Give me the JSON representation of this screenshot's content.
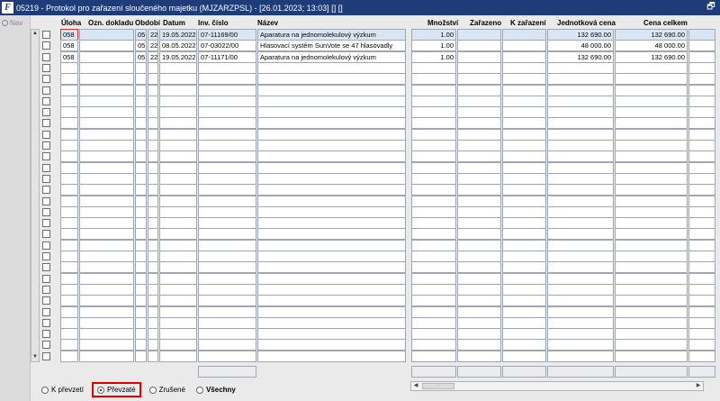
{
  "window": {
    "title": "05219 - Protokol pro zařazení sloučeného majetku (MJZARZPSL) - [26.01.2023; 13:03] [] []",
    "app_icon": "F",
    "restore_glyph": "🗗"
  },
  "nav": {
    "label": "Nav"
  },
  "columns": {
    "uloha": "Úloha",
    "ozn_dokladu": "Ozn. dokladu",
    "obdobi": "Období",
    "datum": "Datum",
    "inv_cislo": "Inv. číslo",
    "nazev": "Název",
    "mnozstvi": "Množství",
    "zarazeno": "Zařazeno",
    "k_zarazeni": "K zařazení",
    "jednotkova_cena": "Jednotková cena",
    "cena_celkem": "Cena celkem"
  },
  "rows": [
    {
      "uloha": "058",
      "ozn": "",
      "o1": "05",
      "o2": "22",
      "datum": "19.05.2022",
      "inv": "07-11169/00",
      "nazev": "Aparatura na jednomolekulový výzkum",
      "mnozstvi": "1.00",
      "zarazeno": "",
      "k_zarazeni": "",
      "jedn_cena": "132 690.00",
      "cena_celkem": "132 690.00"
    },
    {
      "uloha": "058",
      "ozn": "",
      "o1": "05",
      "o2": "22",
      "datum": "08.05.2022",
      "inv": "07-03022/00",
      "nazev": "Hlasovací systém SunVote se 47 hlasovadly",
      "mnozstvi": "1.00",
      "zarazeno": "",
      "k_zarazeni": "",
      "jedn_cena": "48 000.00",
      "cena_celkem": "48 000.00"
    },
    {
      "uloha": "058",
      "ozn": "",
      "o1": "05",
      "o2": "22",
      "datum": "19.05.2022",
      "inv": "07-11171/00",
      "nazev": "Aparatura na jednomolekulový výzkum",
      "mnozstvi": "1.00",
      "zarazeno": "",
      "k_zarazeni": "",
      "jedn_cena": "132 690.00",
      "cena_celkem": "132 690.00"
    }
  ],
  "empty_row_count": 27,
  "filters": {
    "k_prevzeti": "K převzetí",
    "prevzate": "Převzaté",
    "zrusene": "Zrušené",
    "vsechny": "Všechny",
    "selected": "prevzate"
  },
  "colors": {
    "titlebar": "#1e3c78",
    "selected_row": "#dbe6f5",
    "highlight": "#e00000"
  }
}
